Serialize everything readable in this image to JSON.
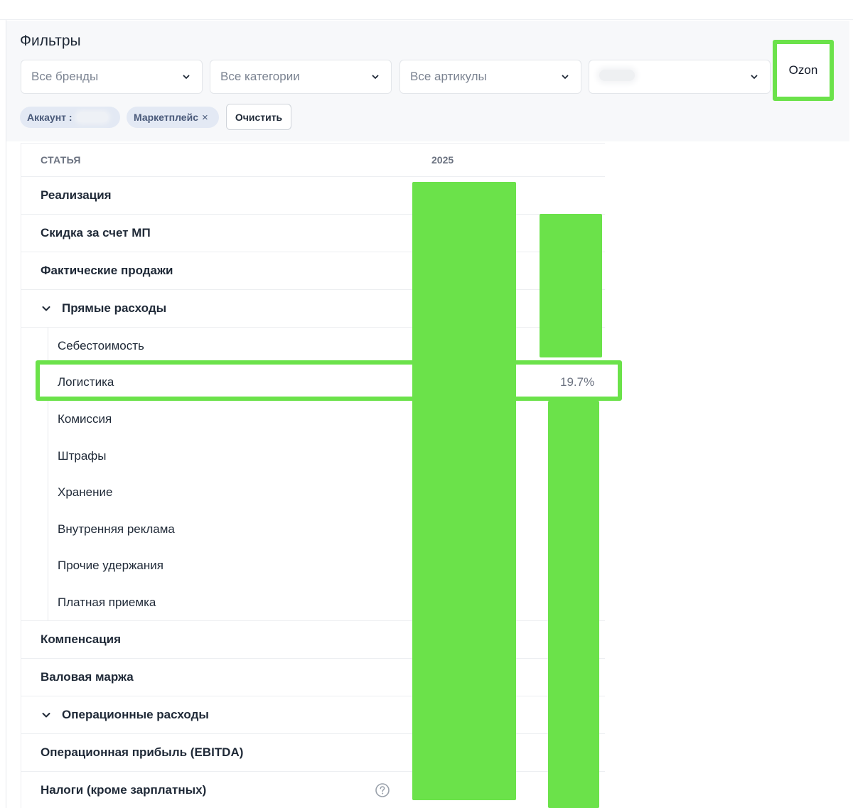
{
  "filters": {
    "title": "Фильтры",
    "brands": "Все бренды",
    "categories": "Все категории",
    "articles": "Все артикулы",
    "marketplace": "Ozon"
  },
  "chips": {
    "account": "Аккаунт :",
    "marketplace": "Маркетплейс",
    "remove": "×",
    "clear": "Очистить"
  },
  "table": {
    "col_item": "СТАТЬЯ",
    "col_year": "2025",
    "rows": {
      "realization": "Реализация",
      "mp_discount": "Скидка за счет МП",
      "actual_sales": "Фактические продажи",
      "direct_costs": "Прямые расходы",
      "cost_price": "Себестоимость",
      "logistics": "Логистика",
      "commission": "Комиссия",
      "fines": "Штрафы",
      "storage": "Хранение",
      "internal_ads": "Внутренняя реклама",
      "other_deductions": "Прочие удержания",
      "paid_acceptance": "Платная приемка",
      "compensation": "Компенсация",
      "gross_margin": "Валовая маржа",
      "operating_costs": "Операционные расходы",
      "ebitda": "Операционная прибыль (EBITDA)",
      "taxes": "Налоги (кроме зарплатных)"
    },
    "logistics_share": "19.7%"
  },
  "colors": {
    "highlight": "#6be24a",
    "chip_bg": "#e3e9f4"
  },
  "icons": {
    "dropdown": "chevron-down-icon",
    "expand": "chevron-down-icon",
    "help": "question-circle-icon"
  }
}
